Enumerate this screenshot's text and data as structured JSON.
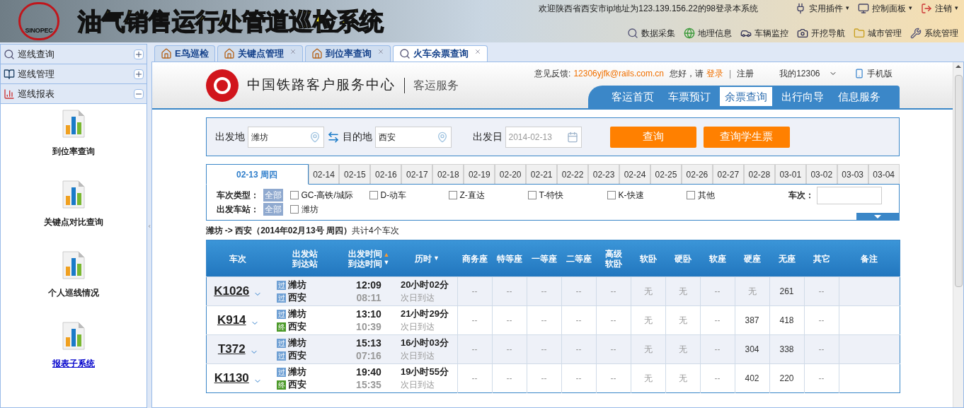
{
  "header": {
    "logo_text": "SINOPEC",
    "title": "油气销售运行处管道巡检系统",
    "welcome": "欢迎陕西省西安市ip地址为123.139.156.22的98登录本系统",
    "top_menus": [
      {
        "label": "实用插件",
        "kind": "plugin",
        "caret": "▾"
      },
      {
        "label": "控制面板",
        "kind": "panel",
        "caret": "▾"
      },
      {
        "label": "注销",
        "kind": "logout",
        "caret": "▾"
      }
    ],
    "nav": [
      {
        "label": "数据采集",
        "kind": "search"
      },
      {
        "label": "地理信息",
        "kind": "globe"
      },
      {
        "label": "车辆监控",
        "kind": "car"
      },
      {
        "label": "开挖导航",
        "kind": "camera"
      },
      {
        "label": "城市管理",
        "kind": "folder"
      },
      {
        "label": "系统管理",
        "kind": "wrench"
      }
    ]
  },
  "sidebar": {
    "sections": [
      {
        "label": "巡线查询",
        "kind": "search",
        "expanded": false
      },
      {
        "label": "巡线管理",
        "kind": "book",
        "expanded": false
      },
      {
        "label": "巡线报表",
        "kind": "chart",
        "expanded": true,
        "items": [
          {
            "label": "到位率查询",
            "kind": "text"
          },
          {
            "label": "关键点对比查询",
            "kind": "text"
          },
          {
            "label": "个人巡线情况",
            "kind": "text"
          },
          {
            "label": "报表子系统",
            "kind": "link"
          }
        ]
      }
    ]
  },
  "tabs": [
    {
      "label": "E鸟巡检",
      "kind": "home",
      "closable": false,
      "selected": false
    },
    {
      "label": "关键点管理",
      "kind": "home",
      "closable": true,
      "selected": false
    },
    {
      "label": "到位率查询",
      "kind": "home",
      "closable": true,
      "selected": false
    },
    {
      "label": "火车余票查询",
      "kind": "search",
      "closable": true,
      "selected": true
    }
  ],
  "railway": {
    "brand": "中国铁路客户服务中心",
    "subbrand": "客运服务",
    "feedback_label": "意见反馈:",
    "feedback_email": "12306yjfk@rails.com.cn",
    "greeting": "您好，请",
    "login": "登录",
    "separator": "|",
    "register": "注册",
    "my": "我的12306",
    "mobile": "手机版",
    "nav": [
      {
        "label": "客运首页",
        "selected": false
      },
      {
        "label": "车票预订",
        "selected": false
      },
      {
        "label": "余票查询",
        "selected": true
      },
      {
        "label": "出行向导",
        "selected": false
      },
      {
        "label": "信息服务",
        "selected": false
      }
    ],
    "search": {
      "from_label": "出发地",
      "from": "潍坊",
      "to_label": "目的地",
      "to": "西安",
      "date_label": "出发日",
      "date": "2014-02-13",
      "buttons": [
        "查询",
        "查询学生票"
      ]
    },
    "dates": [
      {
        "label": "02-13 周四",
        "selected": true
      },
      {
        "label": "02-14",
        "selected": false
      },
      {
        "label": "02-15",
        "selected": false
      },
      {
        "label": "02-16",
        "selected": false
      },
      {
        "label": "02-17",
        "selected": false
      },
      {
        "label": "02-18",
        "selected": false
      },
      {
        "label": "02-19",
        "selected": false
      },
      {
        "label": "02-20",
        "selected": false
      },
      {
        "label": "02-21",
        "selected": false
      },
      {
        "label": "02-22",
        "selected": false
      },
      {
        "label": "02-23",
        "selected": false
      },
      {
        "label": "02-24",
        "selected": false
      },
      {
        "label": "02-25",
        "selected": false
      },
      {
        "label": "02-26",
        "selected": false
      },
      {
        "label": "02-27",
        "selected": false
      },
      {
        "label": "02-28",
        "selected": false
      },
      {
        "label": "03-01",
        "selected": false
      },
      {
        "label": "03-02",
        "selected": false
      },
      {
        "label": "03-03",
        "selected": false
      },
      {
        "label": "03-04",
        "selected": false
      }
    ],
    "filters": {
      "type_label": "车次类型：",
      "type_all": "全部",
      "types": [
        {
          "label": "GC-高铁/城际",
          "checked": false
        },
        {
          "label": "D-动车",
          "checked": false
        },
        {
          "label": "Z-直达",
          "checked": false
        },
        {
          "label": "T-特快",
          "checked": false
        },
        {
          "label": "K-快速",
          "checked": false
        },
        {
          "label": "其他",
          "checked": false
        }
      ],
      "train_no_label": "车次：",
      "station_label": "出发车站：",
      "station_all": "全部",
      "stations": [
        {
          "label": "潍坊",
          "checked": false
        }
      ]
    },
    "summary": "**潍坊 -> 西安（2014年02月13号  周四）**共计4个车次",
    "table": {
      "columns": [
        {
          "lines": [
            "车次"
          ]
        },
        {
          "lines": [
            "出发站",
            "到达站"
          ]
        },
        {
          "lines": [
            "出发时间",
            "到达时间"
          ],
          "marks": [
            {
              "glyph": "▲",
              "active": true
            },
            {
              "glyph": "▼",
              "active": false
            }
          ]
        },
        {
          "lines": [
            "历时"
          ],
          "marks": [
            {
              "glyph": "▼",
              "active": false
            }
          ]
        },
        {
          "lines": [
            "商务座"
          ]
        },
        {
          "lines": [
            "特等座"
          ]
        },
        {
          "lines": [
            "一等座"
          ]
        },
        {
          "lines": [
            "二等座"
          ]
        },
        {
          "lines": [
            "高级",
            "软卧"
          ]
        },
        {
          "lines": [
            "软卧"
          ]
        },
        {
          "lines": [
            "硬卧"
          ]
        },
        {
          "lines": [
            "软座"
          ]
        },
        {
          "lines": [
            "硬座"
          ]
        },
        {
          "lines": [
            "无座"
          ]
        },
        {
          "lines": [
            "其它"
          ]
        },
        {
          "lines": [
            "备注"
          ]
        }
      ],
      "rows": [
        {
          "train": "K1026",
          "from": {
            "badge": "过",
            "kind": "pass",
            "name": "潍坊"
          },
          "to": {
            "badge": "过",
            "kind": "pass",
            "name": "西安"
          },
          "depart": "12:09",
          "arrive": "08:11",
          "duration": "20小时02分",
          "note": "次日到达",
          "seats": [
            "--",
            "--",
            "--",
            "--",
            "--",
            "无",
            "无",
            "--",
            "无",
            "261",
            "--"
          ]
        },
        {
          "train": "K914",
          "from": {
            "badge": "过",
            "kind": "pass",
            "name": "潍坊"
          },
          "to": {
            "badge": "终",
            "kind": "end",
            "name": "西安"
          },
          "depart": "13:10",
          "arrive": "10:39",
          "duration": "21小时29分",
          "note": "次日到达",
          "seats": [
            "--",
            "--",
            "--",
            "--",
            "--",
            "无",
            "无",
            "--",
            "387",
            "418",
            "--"
          ]
        },
        {
          "train": "T372",
          "from": {
            "badge": "过",
            "kind": "pass",
            "name": "潍坊"
          },
          "to": {
            "badge": "过",
            "kind": "pass",
            "name": "西安"
          },
          "depart": "15:13",
          "arrive": "07:16",
          "duration": "16小时03分",
          "note": "次日到达",
          "seats": [
            "--",
            "--",
            "--",
            "--",
            "--",
            "无",
            "无",
            "--",
            "304",
            "338",
            "--"
          ]
        },
        {
          "train": "K1130",
          "from": {
            "badge": "过",
            "kind": "pass",
            "name": "潍坊"
          },
          "to": {
            "badge": "终",
            "kind": "end",
            "name": "西安"
          },
          "depart": "19:40",
          "arrive": "15:35",
          "duration": "19小时55分",
          "note": "次日到达",
          "seats": [
            "--",
            "--",
            "--",
            "--",
            "--",
            "无",
            "无",
            "--",
            "402",
            "220",
            "--"
          ]
        }
      ]
    }
  }
}
